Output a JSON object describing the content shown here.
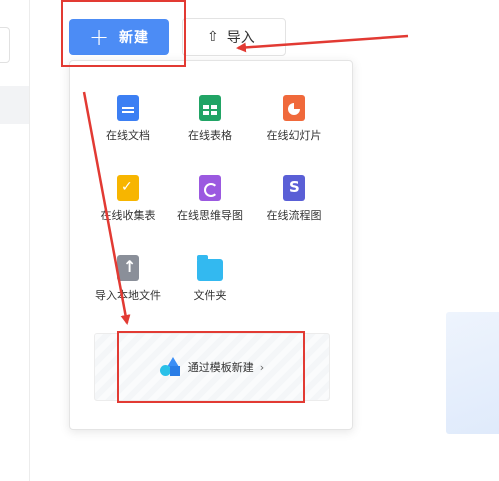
{
  "header": {
    "new_button": {
      "icon": "plus-icon",
      "label": "新建"
    },
    "import_button": {
      "icon": "upload-icon",
      "label": "导入"
    }
  },
  "menu": {
    "items": [
      {
        "label": "在线文档",
        "icon": "doc-icon"
      },
      {
        "label": "在线表格",
        "icon": "sheet-icon"
      },
      {
        "label": "在线幻灯片",
        "icon": "slides-icon"
      },
      {
        "label": "在线收集表",
        "icon": "form-icon"
      },
      {
        "label": "在线思维导图",
        "icon": "mindmap-icon"
      },
      {
        "label": "在线流程图",
        "icon": "flowchart-icon"
      },
      {
        "label": "导入本地文件",
        "icon": "upload-file-icon"
      },
      {
        "label": "文件夹",
        "icon": "folder-icon"
      }
    ],
    "template": {
      "label": "通过模板新建",
      "chevron": "›",
      "icon": "shapes-icon"
    }
  },
  "colors": {
    "primary": "#4c8cf5",
    "annotation_red": "#e23a33"
  }
}
